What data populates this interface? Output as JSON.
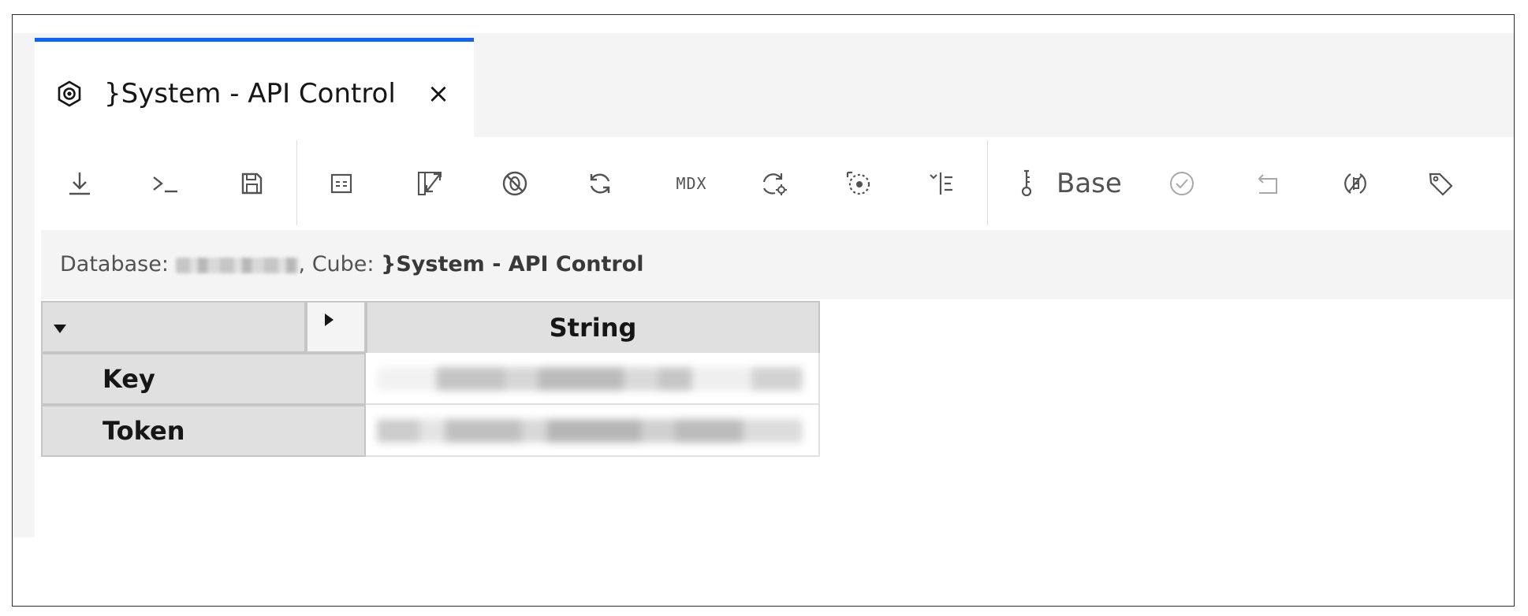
{
  "tab": {
    "title": "}System - API Control",
    "close_glyph": "×",
    "icon": "cube-view-icon"
  },
  "toolbar": {
    "buttons": [
      {
        "name": "export-icon"
      },
      {
        "name": "terminal-icon"
      },
      {
        "name": "save-icon"
      },
      {
        "name": "properties-icon"
      },
      {
        "name": "expand-icon"
      },
      {
        "name": "suppress-zeros-icon"
      },
      {
        "name": "refresh-icon"
      },
      {
        "name": "mdx-icon",
        "label": "MDX"
      },
      {
        "name": "recalculate-icon"
      },
      {
        "name": "focus-icon"
      },
      {
        "name": "sort-icon"
      },
      {
        "name": "sandbox-icon"
      },
      {
        "name": "commit-icon"
      },
      {
        "name": "revert-icon"
      },
      {
        "name": "spreading-icon"
      },
      {
        "name": "tag-icon"
      }
    ],
    "sandbox_label": "Base"
  },
  "info": {
    "database_label": "Database:",
    "cube_label": ", Cube:",
    "cube_name": "}System - API Control"
  },
  "grid": {
    "column_header": "String",
    "rows": [
      {
        "label": "Key"
      },
      {
        "label": "Token"
      }
    ]
  }
}
